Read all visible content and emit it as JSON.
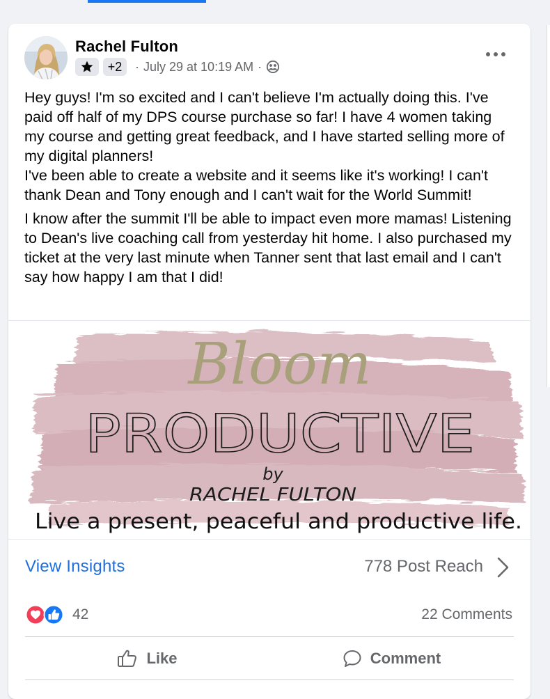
{
  "post": {
    "author": "Rachel Fulton",
    "badge_more": "+2",
    "time": "July 29 at 10:19 AM",
    "separator": "·",
    "text_p1": "Hey guys! I'm so excited and I can't believe I'm actually doing this. I've paid off half of my DPS course purchase so far! I have 4 women taking my course and getting great feedback, and I have started selling more of my digital planners!\nI've been able to create a website and it seems like it's working! I can't thank Dean and Tony enough and I can't wait for the World Summit!",
    "text_p2": "I know after the summit I'll be able to impact even more mamas! Listening to Dean's live coaching call from yesterday hit home. I also purchased my ticket at the very last minute when Tanner sent that last email and I can't say how happy I am that I did!"
  },
  "image": {
    "script_word": "Bloom",
    "title_word": "PRODUCTIVE",
    "by": "by",
    "name": "RACHEL FULTON",
    "tagline": "Live a present, peaceful and productive life."
  },
  "insights": {
    "view_label": "View Insights",
    "reach": "778 Post Reach"
  },
  "reactions": {
    "count": "42",
    "comments": "22 Comments"
  },
  "actions": {
    "like": "Like",
    "comment": "Comment"
  },
  "icons": {
    "badge_star": "star-icon",
    "audience": "group-icon",
    "more": "more-options-icon",
    "chevron": "chevron-right-icon",
    "love": "love-reaction-icon",
    "like_reaction": "like-reaction-icon",
    "like_action": "thumbs-up-icon",
    "comment_action": "speech-bubble-icon"
  },
  "colors": {
    "link_blue": "#216fdb",
    "facebook_blue": "#1877f2",
    "love_red": "#f33e58",
    "secondary_text": "#65676b",
    "brush_pink": "#d8b5bc",
    "script_olive": "#a8a07a"
  }
}
